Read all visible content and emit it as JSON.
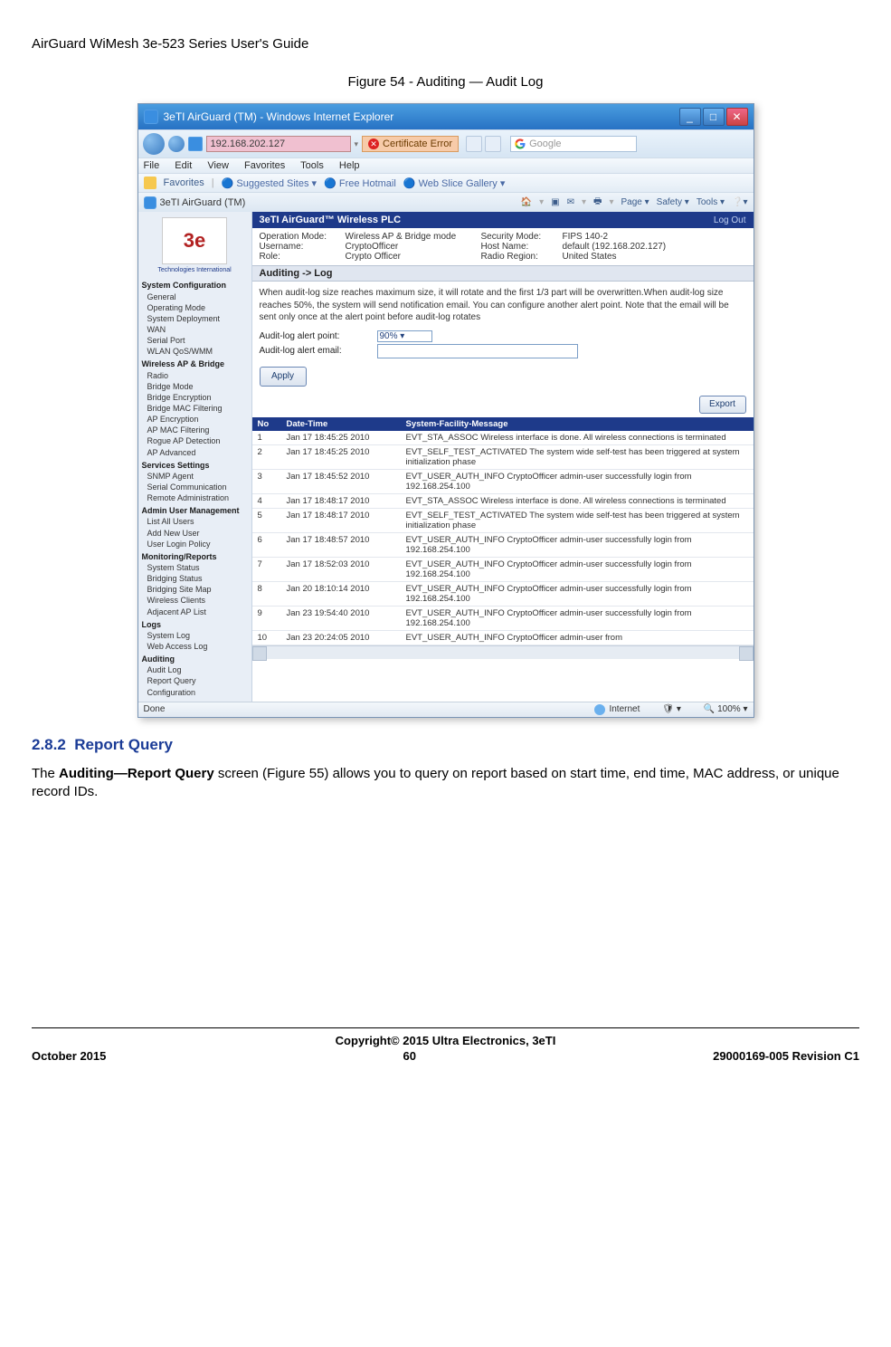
{
  "doc_header": "AirGuard WiMesh 3e-523 Series User's Guide",
  "figure_caption": "Figure 54 - Auditing — Audit Log",
  "window": {
    "title": "3eTI AirGuard (TM) - Windows Internet Explorer",
    "address": "192.168.202.127",
    "cert_error": "Certificate Error",
    "search_placeholder": "Google",
    "menus": [
      "File",
      "Edit",
      "View",
      "Favorites",
      "Tools",
      "Help"
    ],
    "favbar_label": "Favorites",
    "fav_links": [
      "Suggested Sites",
      "Free Hotmail",
      "Web Slice Gallery"
    ],
    "tab_name": "3eTI AirGuard (TM)",
    "right_tools": [
      "Page",
      "Safety",
      "Tools"
    ],
    "status_done": "Done",
    "status_zone": "Internet",
    "zoom": "100%"
  },
  "sidebar": {
    "logo_sub": "Technologies International",
    "groups": [
      {
        "head": "System Configuration",
        "items": [
          "General",
          "Operating Mode",
          "System Deployment",
          "WAN",
          "Serial Port",
          "WLAN QoS/WMM"
        ]
      },
      {
        "head": "Wireless AP & Bridge",
        "items": [
          "Radio",
          "Bridge Mode",
          "Bridge Encryption",
          "Bridge MAC Filtering",
          "AP Encryption",
          "AP MAC Filtering",
          "Rogue AP Detection",
          "AP Advanced"
        ]
      },
      {
        "head": "Services Settings",
        "items": [
          "SNMP Agent",
          "Serial Communication",
          "Remote Administration"
        ]
      },
      {
        "head": "Admin User Management",
        "items": [
          "List All Users",
          "Add New User",
          "User Login Policy"
        ]
      },
      {
        "head": "Monitoring/Reports",
        "items": [
          "System Status",
          "Bridging Status",
          "Bridging Site Map",
          "Wireless Clients",
          "Adjacent AP List"
        ]
      },
      {
        "head": "Logs",
        "items": [
          "System Log",
          "Web Access Log"
        ]
      },
      {
        "head": "Auditing",
        "items": [
          "Audit Log",
          "Report Query",
          "Configuration"
        ]
      }
    ]
  },
  "panel": {
    "product": "3eTI AirGuard™ Wireless PLC",
    "logout": "Log Out",
    "info": {
      "op_mode_lbl": "Operation Mode:",
      "op_mode_val": "Wireless AP & Bridge mode",
      "user_lbl": "Username:",
      "user_val": "CryptoOfficer",
      "role_lbl": "Role:",
      "role_val": "Crypto Officer",
      "sec_lbl": "Security Mode:",
      "sec_val": "FIPS 140-2",
      "host_lbl": "Host Name:",
      "host_val": "default (192.168.202.127)",
      "radio_lbl": "Radio Region:",
      "radio_val": "United States"
    },
    "section": "Auditing -> Log",
    "desc": "When audit-log size reaches maximum size, it will rotate and the first 1/3 part will be overwritten.When audit-log size reaches 50%, the system will send notification email. You can configure another alert point. Note that the email will be sent only once at the alert point before audit-log rotates",
    "alert_point_lbl": "Audit-log alert point:",
    "alert_point_val": "90%",
    "alert_email_lbl": "Audit-log alert email:",
    "apply": "Apply",
    "export": "Export",
    "cols": {
      "no": "No",
      "dt": "Date-Time",
      "msg": "System-Facility-Message"
    },
    "rows": [
      {
        "no": "1",
        "dt": "Jan 17 18:45:25 2010",
        "msg": "EVT_STA_ASSOC Wireless interface is done. All wireless connections is terminated"
      },
      {
        "no": "2",
        "dt": "Jan 17 18:45:25 2010",
        "msg": "EVT_SELF_TEST_ACTIVATED The system wide self-test has been triggered at system initialization phase"
      },
      {
        "no": "3",
        "dt": "Jan 17 18:45:52 2010",
        "msg": "EVT_USER_AUTH_INFO CryptoOfficer admin-user successfully login from 192.168.254.100"
      },
      {
        "no": "4",
        "dt": "Jan 17 18:48:17 2010",
        "msg": "EVT_STA_ASSOC Wireless interface is done. All wireless connections is terminated"
      },
      {
        "no": "5",
        "dt": "Jan 17 18:48:17 2010",
        "msg": "EVT_SELF_TEST_ACTIVATED The system wide self-test has been triggered at system initialization phase"
      },
      {
        "no": "6",
        "dt": "Jan 17 18:48:57 2010",
        "msg": "EVT_USER_AUTH_INFO CryptoOfficer admin-user successfully login from 192.168.254.100"
      },
      {
        "no": "7",
        "dt": "Jan 17 18:52:03 2010",
        "msg": "EVT_USER_AUTH_INFO CryptoOfficer admin-user successfully login from 192.168.254.100"
      },
      {
        "no": "8",
        "dt": "Jan 20 18:10:14 2010",
        "msg": "EVT_USER_AUTH_INFO CryptoOfficer admin-user successfully login from 192.168.254.100"
      },
      {
        "no": "9",
        "dt": "Jan 23 19:54:40 2010",
        "msg": "EVT_USER_AUTH_INFO CryptoOfficer admin-user successfully login from 192.168.254.100"
      },
      {
        "no": "10",
        "dt": "Jan 23 20:24:05 2010",
        "msg": "EVT_USER_AUTH_INFO CryptoOfficer admin-user from"
      }
    ]
  },
  "section_num": "2.8.2",
  "section_name": "Report Query",
  "body_para_pre": "The ",
  "body_bold": "Auditing—Report Query",
  "body_para_post": " screen (Figure 55) allows you to query on report based on start time, end time, MAC address, or unique record IDs.",
  "footer": {
    "copy": "Copyright© 2015 Ultra Electronics, 3eTI",
    "left": "October 2015",
    "center": "60",
    "right": "29000169-005 Revision C1"
  }
}
